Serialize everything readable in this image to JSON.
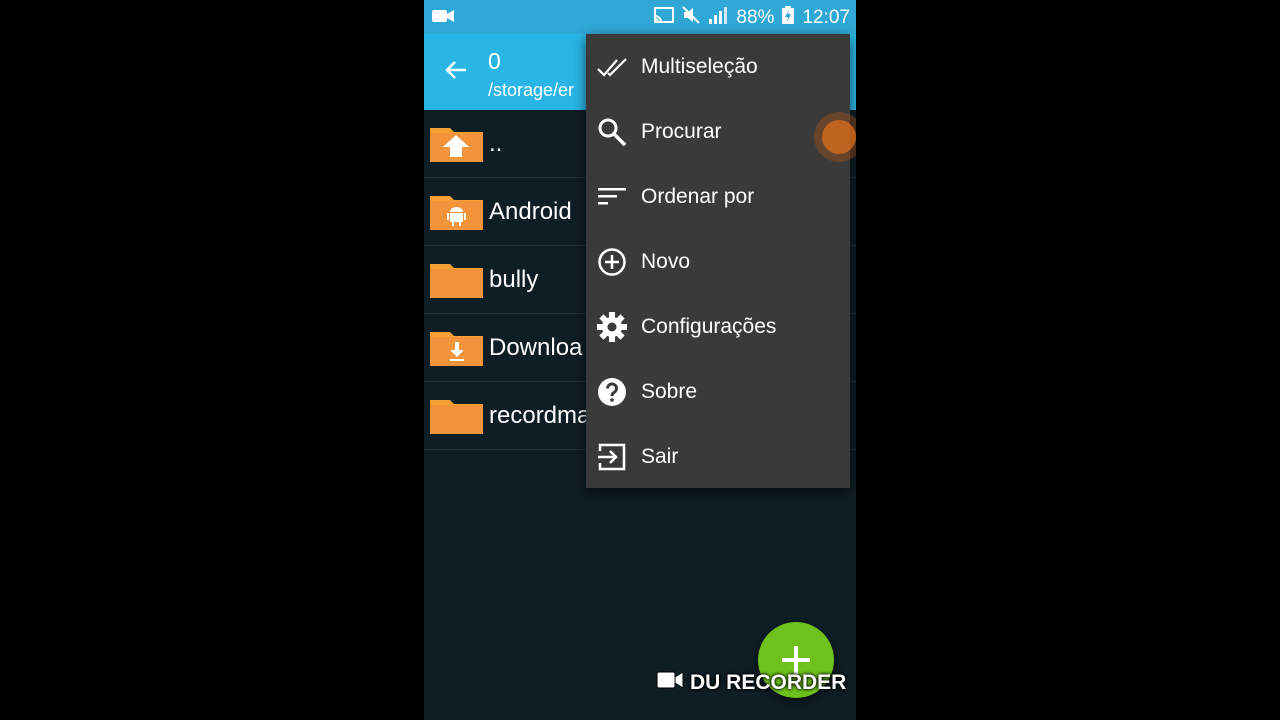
{
  "status_bar": {
    "battery": "88%",
    "time": "12:07",
    "icons": [
      "video-camera-icon",
      "cast-icon",
      "mute-icon",
      "signal-icon",
      "battery-charging-icon"
    ]
  },
  "toolbar": {
    "title": "0",
    "path": "/storage/er"
  },
  "files": [
    {
      "name": "..",
      "icon": "folder-up-icon"
    },
    {
      "name": "Android",
      "icon": "folder-android-icon"
    },
    {
      "name": "bully",
      "icon": "folder-icon"
    },
    {
      "name": "Downloa",
      "icon": "folder-download-icon"
    },
    {
      "name": "recordma",
      "icon": "folder-icon"
    }
  ],
  "menu": {
    "items": [
      {
        "label": "Multiseleção",
        "icon": "double-check-icon"
      },
      {
        "label": "Procurar",
        "icon": "search-icon"
      },
      {
        "label": "Ordenar por",
        "icon": "sort-icon"
      },
      {
        "label": "Novo",
        "icon": "plus-circle-icon"
      },
      {
        "label": "Configurações",
        "icon": "gear-icon"
      },
      {
        "label": "Sobre",
        "icon": "help-icon"
      },
      {
        "label": "Sair",
        "icon": "exit-icon"
      }
    ]
  },
  "watermark": {
    "text": "DU RECORDER"
  },
  "colors": {
    "toolbar": "#29b6e6",
    "statusbar": "#2fa8d6",
    "background": "#0f1d24",
    "menu": "#3a3a3a",
    "folder": "#f7a035",
    "fab": "#6fc21c"
  }
}
